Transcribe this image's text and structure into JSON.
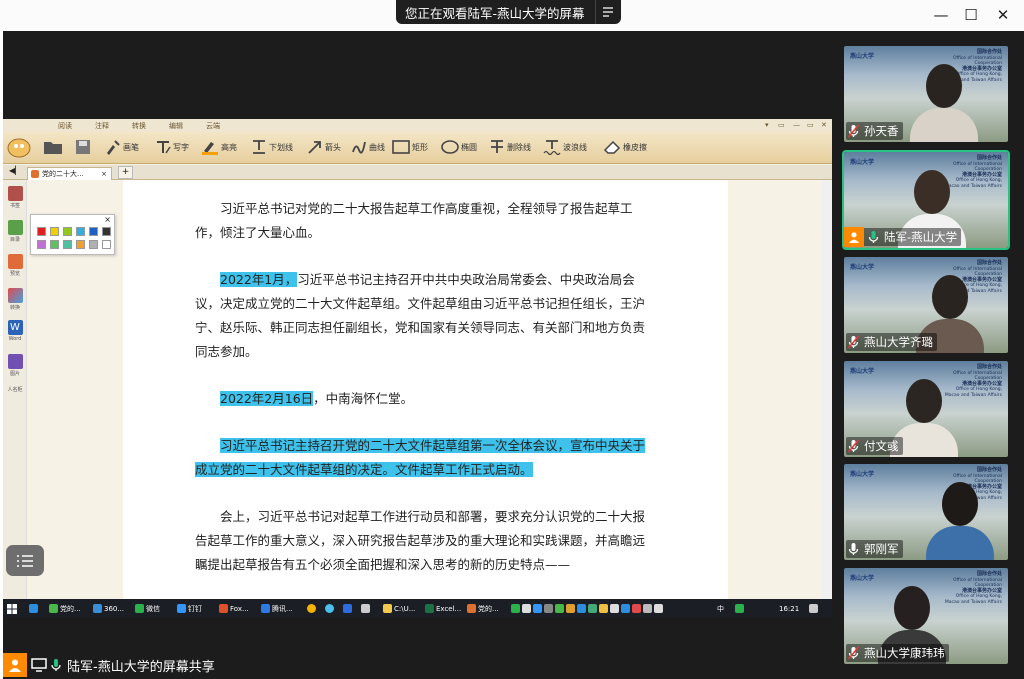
{
  "banner": {
    "text": "您正在观看陆军-燕山大学的屏幕"
  },
  "window_controls": {
    "minimize": "—",
    "maximize": "☐",
    "close": "✕"
  },
  "ribbon": {
    "tabs": [
      "阅读",
      "注释",
      "转换",
      "编辑",
      "云端"
    ],
    "tools": [
      "画笔",
      "写字",
      "高亮",
      "下划线",
      "箭头",
      "曲线",
      "矩形",
      "椭圆",
      "删除线",
      "波浪线",
      "橡皮擦"
    ],
    "window_buttons": [
      "▾",
      "▭",
      "—",
      "▭",
      "✕"
    ]
  },
  "doc_tab": {
    "title": "党的二十大...",
    "close": "×",
    "add": "+"
  },
  "sidebar": [
    "书签",
    "目录",
    "预览",
    "转换",
    "Word",
    "图片",
    "人名柜"
  ],
  "document": {
    "paragraphs": [
      {
        "pre": "",
        "hl": "",
        "text": "习近平总书记对党的二十大报告起草工作高度重视，全程领导了报告起草工作，倾注了大量心血。"
      },
      {
        "pre": "",
        "hl": "2022年1月，",
        "text": "习近平总书记主持召开中共中央政治局常委会、中央政治局会议，决定成立党的二十大文件起草组。文件起草组由习近平总书记担任组长，王沪宁、赵乐际、韩正同志担任副组长，党和国家有关领导同志、有关部门和地方负责同志参加。"
      },
      {
        "pre": "",
        "hl": "2022年2月16日",
        "text": "，中南海怀仁堂。"
      },
      {
        "pre": "",
        "hl": "习近平总书记主持召开党的二十大文件起草组第一次全体会议，宣布中央关于成立党的二十大文件起草组的决定。文件起草工作正式启动。",
        "text": ""
      },
      {
        "pre": "",
        "hl": "",
        "text": "会上，习近平总书记对起草工作进行动员和部署，要求充分认识党的二十大报告起草工作的重大意义，深入研究报告起草涉及的重大理论和实践课题，并高瞻远瞩提出起草报告有五个必须全面把握和深入思考的新的历史特点——"
      }
    ]
  },
  "taskbar": {
    "items": [
      "党的...",
      "360...",
      "微信",
      "钉钉",
      "Fox...",
      "腾讯...",
      "C:\\U...",
      "Excel...",
      "党的..."
    ],
    "tray": "中",
    "time": "16:21"
  },
  "share_label": "陆军-燕山大学的屏幕共享",
  "participants": [
    {
      "name": "孙天香",
      "active": false,
      "host": false
    },
    {
      "name": "陆军-燕山大学",
      "active": true,
      "host": true
    },
    {
      "name": "燕山大学齐璐",
      "active": false,
      "host": false
    },
    {
      "name": "付文彧",
      "active": false,
      "host": false
    },
    {
      "name": "郭刚军",
      "active": false,
      "host": false
    },
    {
      "name": "燕山大学康玮玮",
      "active": false,
      "host": false
    }
  ],
  "backdrop": {
    "logo": "燕山大学",
    "office_cn1": "国际合作处",
    "office_en1": "Office of International Cooperation",
    "office_cn2": "港澳台事务办公室",
    "office_en2": "Office of Hong Kong, Macao and Taiwan Affairs"
  },
  "colors": {
    "accent": "#26c281",
    "highlight": "#3ec2ec",
    "swatches": [
      "#e02020",
      "#f0d000",
      "#90c820",
      "#30b0e0",
      "#2060c0",
      "#333333",
      "#c070d0",
      "#60c060",
      "#50c0a0",
      "#f0a030",
      "#b0b0b0",
      "#ffffff"
    ]
  }
}
